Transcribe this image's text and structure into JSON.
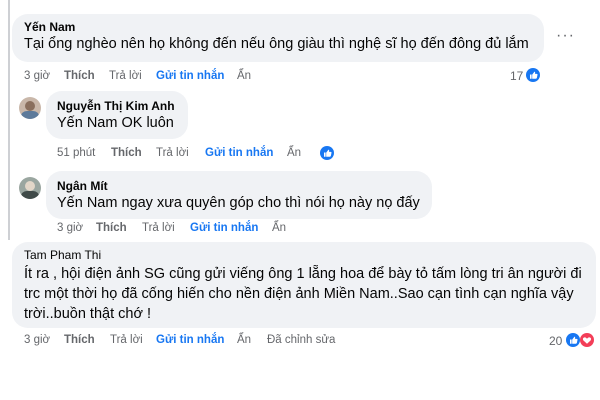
{
  "comments": [
    {
      "author": "Yến Nam",
      "text": "Tại ổng nghèo nên họ không đến nếu ông giàu thì nghệ sĩ họ đến đông đủ lắm",
      "time": "3 giờ",
      "like_label": "Thích",
      "reply_label": "Trả lời",
      "message_label": "Gửi tin nhắn",
      "hide_label": "Ẩn",
      "reaction_count": "17",
      "reaction_icon": "like-icon"
    },
    {
      "author": "Nguyễn Thị Kim Anh",
      "mention": "Yến Nam",
      "text": " OK luôn",
      "time": "51 phút",
      "like_label": "Thích",
      "reply_label": "Trả lời",
      "message_label": "Gửi tin nhắn",
      "hide_label": "Ẩn",
      "reaction_icon": "like-icon"
    },
    {
      "author": "Ngân Mít",
      "mention": "Yến Nam",
      "text": " ngay xưa quyên góp cho thì nói họ này nọ đấy",
      "time": "3 giờ",
      "like_label": "Thích",
      "reply_label": "Trả lời",
      "message_label": "Gửi tin nhắn",
      "hide_label": "Ẩn"
    },
    {
      "author": "Tam Pham Thi",
      "lines": [
        "Ít ra , hội điện ảnh SG cũng gửi viếng ông 1 lẵng hoa để bày tỏ tấm lòng tri ân người đi",
        "trc một thời họ đã cống hiến cho nền điện ảnh Miền Nam..Sao cạn tình cạn nghĩa vậy",
        "trời..buồn thật chớ !"
      ],
      "time": "3 giờ",
      "like_label": "Thích",
      "reply_label": "Trả lời",
      "message_label": "Gửi tin nhắn",
      "hide_label": "Ẩn",
      "edited_label": "Đã chỉnh sửa",
      "reaction_count": "20",
      "reaction_icons": [
        "like-icon",
        "heart-icon"
      ]
    }
  ],
  "more_options": "···",
  "colors": {
    "accent": "#1877f2",
    "bubble": "#f0f2f5",
    "muted": "#65676b",
    "heart": "#f33e58"
  }
}
